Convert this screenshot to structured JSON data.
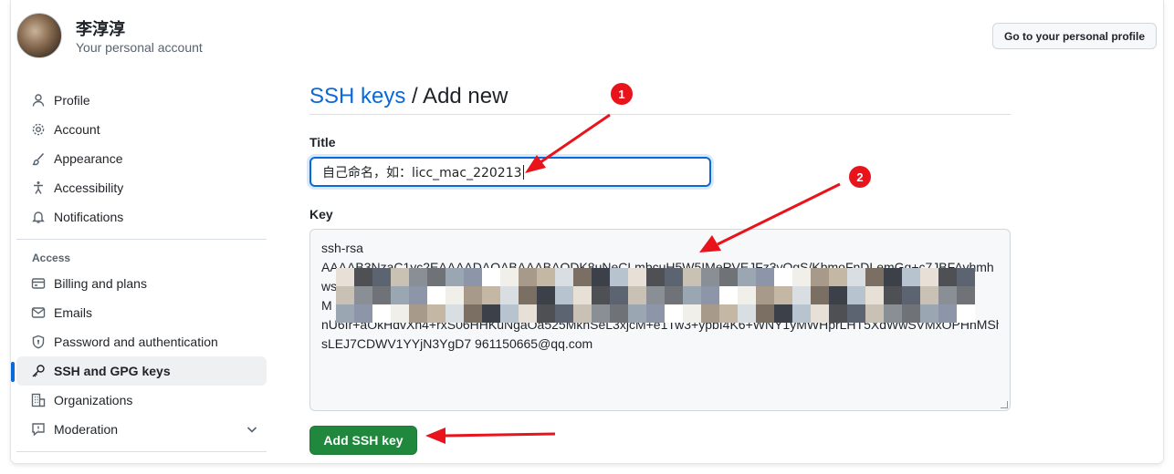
{
  "header": {
    "user_name": "李淳淳",
    "subtitle": "Your personal account",
    "profile_button": "Go to your personal profile"
  },
  "sidebar": {
    "items": [
      {
        "label": "Profile",
        "icon": "person-icon"
      },
      {
        "label": "Account",
        "icon": "gear-icon"
      },
      {
        "label": "Appearance",
        "icon": "paintbrush-icon"
      },
      {
        "label": "Accessibility",
        "icon": "accessibility-icon"
      },
      {
        "label": "Notifications",
        "icon": "bell-icon"
      }
    ],
    "access_heading": "Access",
    "access_items": [
      {
        "label": "Billing and plans",
        "icon": "credit-card-icon"
      },
      {
        "label": "Emails",
        "icon": "mail-icon"
      },
      {
        "label": "Password and authentication",
        "icon": "shield-lock-icon"
      },
      {
        "label": "SSH and GPG keys",
        "icon": "key-icon",
        "active": true
      },
      {
        "label": "Organizations",
        "icon": "organization-icon"
      },
      {
        "label": "Moderation",
        "icon": "report-icon"
      }
    ]
  },
  "main": {
    "breadcrumb": "SSH keys",
    "title_suffix": " / Add new",
    "title_label": "Title",
    "title_value": "自己命名，如：licc_mac_220213",
    "key_label": "Key",
    "key_lines": [
      "ssh-rsa",
      "AAAAB3NzaC1yc2EAAAADAQABAAABAQDK8uNeCLmbcuH5W5IMeRVEJFz3vOgS/KbmoFnDLemGq+c7JBFAvhmh",
      "ws",
      "M",
      "nU6Ir+aOkHdvXh4+rxS06HHKuNgaOa525MkhSeL3xjcM+e1Tw3+ypbI4K6+WNY1yMWHprLHT5XdWwSVMxOPHhMShA",
      "sLEJ7CDWV1YYjN3YgD7 961150665@qq.com"
    ],
    "add_button": "Add SSH key"
  },
  "annotations": {
    "badge_1": "1",
    "badge_2": "2",
    "color": "#e8131b"
  },
  "colors": {
    "link": "#0969da",
    "primary_button": "#1f883d",
    "active_indicator": "#0969da"
  }
}
